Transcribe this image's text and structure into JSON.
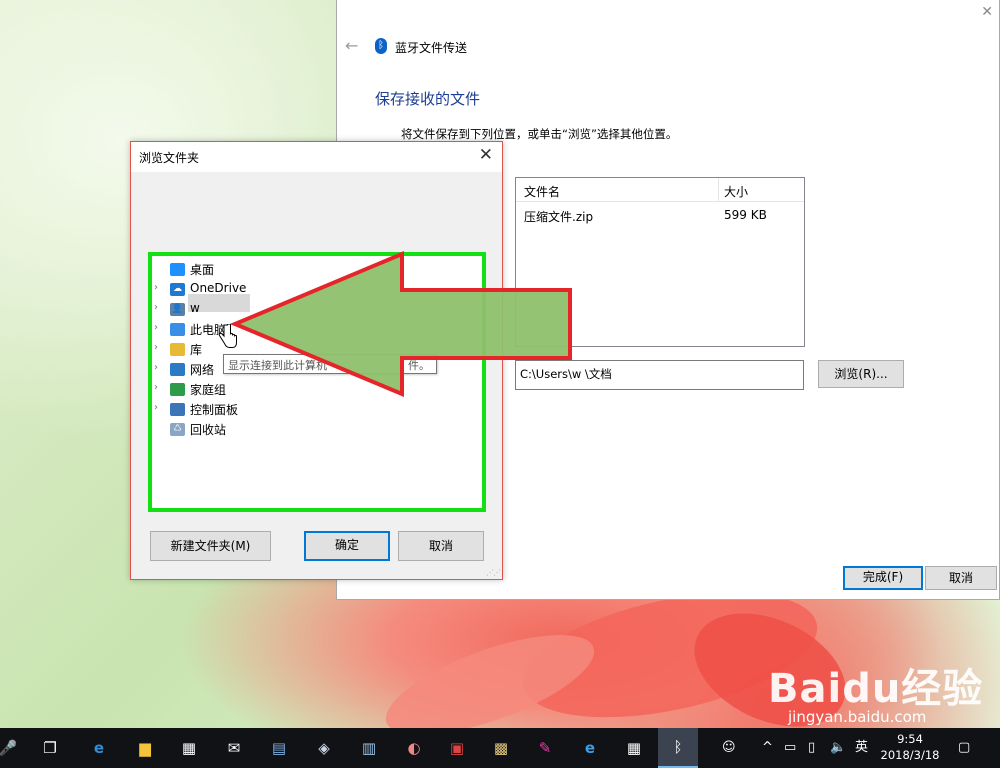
{
  "wizard": {
    "title": "蓝牙文件传送",
    "heading": "保存接收的文件",
    "instruction": "将文件保存到下列位置，或单击“浏览”选择其他位置。",
    "columns": {
      "name": "文件名",
      "size": "大小"
    },
    "files": [
      {
        "name": "压缩文件.zip",
        "size": "599 KB"
      }
    ],
    "save_path": "C:\\Users\\w       \\文档",
    "browse_label": "浏览(R)...",
    "finish_label": "完成(F)",
    "cancel_label": "取消"
  },
  "dialog": {
    "title": "浏览文件夹",
    "tree": [
      {
        "label": "桌面",
        "icon": "desktop-icon",
        "expander": false,
        "color": "#1e90ff"
      },
      {
        "label": "OneDrive",
        "icon": "onedrive-icon",
        "expander": true,
        "color": "#1f78d1"
      },
      {
        "label": "w",
        "icon": "user-icon",
        "expander": true,
        "color": "#5b7fa6"
      },
      {
        "label": "此电脑",
        "icon": "computer-icon",
        "expander": true,
        "color": "#3a8ee6"
      },
      {
        "label": "库",
        "icon": "library-icon",
        "expander": true,
        "color": "#e8b934"
      },
      {
        "label": "网络",
        "icon": "network-icon",
        "expander": true,
        "color": "#2c79c5"
      },
      {
        "label": "家庭组",
        "icon": "homegroup-icon",
        "expander": true,
        "color": "#2d9b49"
      },
      {
        "label": "控制面板",
        "icon": "control-panel-icon",
        "expander": true,
        "color": "#3b75b8"
      },
      {
        "label": "回收站",
        "icon": "recycle-bin-icon",
        "expander": false,
        "color": "#8aa6c4"
      }
    ],
    "tooltip": "显示连接到此计算机",
    "tooltip_tail": "件。",
    "new_folder_label": "新建文件夹(M)",
    "ok_label": "确定",
    "cancel_label": "取消"
  },
  "taskbar": {
    "icons": [
      "microphone-icon",
      "task-view-icon",
      "edge-icon",
      "file-explorer-icon",
      "store-icon",
      "mail-icon",
      "app-icon-1",
      "app-icon-2",
      "app-icon-3",
      "app-icon-4",
      "app-icon-5",
      "app-icon-6",
      "paint-icon",
      "ie-icon",
      "calculator-icon",
      "bluetooth-icon"
    ],
    "time": "9:54",
    "date": "2018/3/18",
    "ime": "英"
  },
  "watermark": {
    "brand": "Baidu经验",
    "site": "jingyan.baidu.com"
  },
  "colors": {
    "highlight_green": "#12e012",
    "arrow_red": "#e5252a",
    "arrow_fill": "#8ec06c",
    "accent": "#0078d7"
  }
}
